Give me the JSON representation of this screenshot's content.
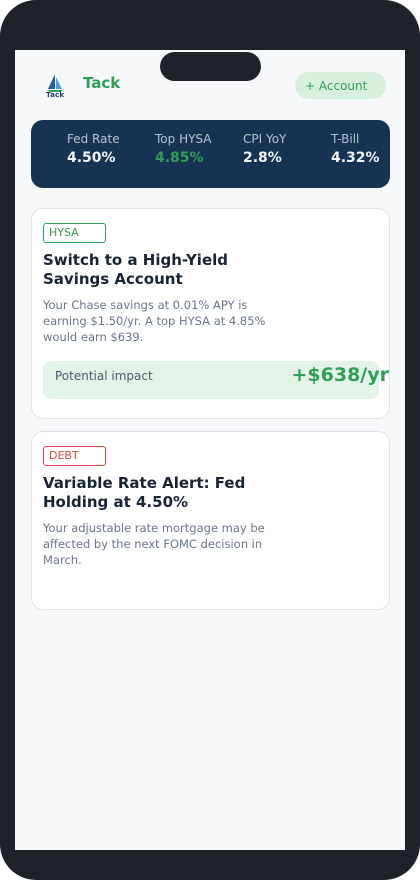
{
  "header": {
    "logo_text": "Tack",
    "brand": "Tack",
    "account_icon": "plus-icon",
    "account_label": "+ Account"
  },
  "rates": [
    {
      "label": "Fed Rate",
      "value": "4.50%"
    },
    {
      "label": "Top HYSA",
      "value": "4.85%"
    },
    {
      "label": "CPI YoY",
      "value": "2.8%"
    },
    {
      "label": "T-Bill",
      "value": "4.32%"
    }
  ],
  "cards": [
    {
      "tag": "HYSA",
      "title": "Switch to a High-Yield Savings Account",
      "description": "Your Chase savings at 0.01% APY is earning $1.50/yr. A top HYSA at 4.85% would earn $639.",
      "impact_label": "Potential impact",
      "impact_value": "+$638/yr"
    },
    {
      "tag": "DEBT",
      "title": "Variable Rate Alert: Fed Holding at 4.50%",
      "description": "Your adjustable rate mortgage may be affected by the next FOMC decision in March."
    }
  ],
  "colors": {
    "accent": "#2f9e57",
    "ticker_bg": "#163353",
    "alert": "#d64545"
  }
}
